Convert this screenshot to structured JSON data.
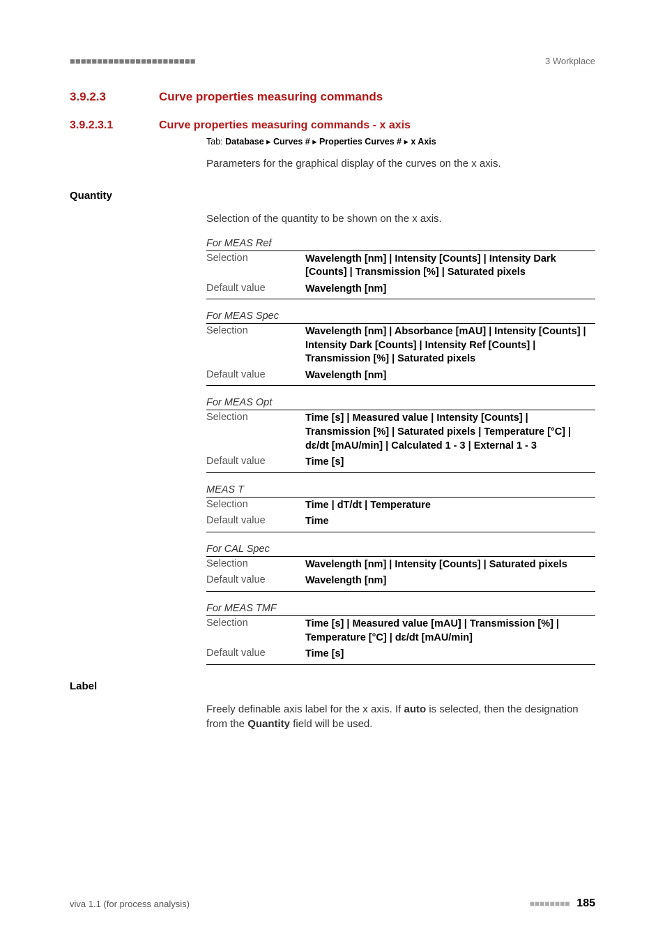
{
  "header": {
    "marks": "■■■■■■■■■■■■■■■■■■■■■■■",
    "right": "3 Workplace"
  },
  "section": {
    "num": "3.9.2.3",
    "title": "Curve properties measuring commands"
  },
  "subsection": {
    "num": "3.9.2.3.1",
    "title": "Curve properties measuring commands - x axis"
  },
  "tabline": {
    "label": "Tab: ",
    "p1": "Database",
    "sep": " ▸ ",
    "p2": "Curves #",
    "p3": "Properties Curves #",
    "p4": "x Axis"
  },
  "intro": "Parameters for the graphical display of the curves on the x axis.",
  "quantity": {
    "heading": "Quantity",
    "lead": "Selection of the quantity to be shown on the x axis.",
    "groups": [
      {
        "title": "For MEAS Ref",
        "rows": [
          {
            "k": "Selection",
            "v": "Wavelength [nm] | Intensity [Counts] | Intensity Dark [Counts] | Transmission [%] | Saturated pixels"
          },
          {
            "k": "Default value",
            "v": "Wavelength [nm]"
          }
        ]
      },
      {
        "title": "For MEAS Spec",
        "rows": [
          {
            "k": "Selection",
            "v": "Wavelength [nm] | Absorbance [mAU] | Intensity [Counts] | Intensity Dark [Counts] | Intensity Ref [Counts] | Transmission [%] | Saturated pixels"
          },
          {
            "k": "Default value",
            "v": "Wavelength [nm]"
          }
        ]
      },
      {
        "title": "For MEAS Opt",
        "rows": [
          {
            "k": "Selection",
            "v": "Time [s] | Measured value | Intensity [Counts] | Transmission [%] | Saturated pixels | Temperature [°C] | dɛ/dt [mAU/min] | Calculated 1 - 3 | External 1 - 3"
          },
          {
            "k": "Default value",
            "v": "Time [s]"
          }
        ]
      },
      {
        "title": "MEAS T",
        "rows": [
          {
            "k": "Selection",
            "v": "Time | dT/dt | Temperature"
          },
          {
            "k": "Default value",
            "v": "Time"
          }
        ]
      },
      {
        "title": "For CAL Spec",
        "rows": [
          {
            "k": "Selection",
            "v": "Wavelength [nm] | Intensity [Counts] | Saturated pixels"
          },
          {
            "k": "Default value",
            "v": "Wavelength [nm]"
          }
        ]
      },
      {
        "title": "For MEAS TMF",
        "rows": [
          {
            "k": "Selection",
            "v": "Time [s] | Measured value [mAU] | Transmission [%] | Temperature [°C] | dɛ/dt [mAU/min]"
          },
          {
            "k": "Default value",
            "v": "Time [s]"
          }
        ]
      }
    ]
  },
  "label_section": {
    "heading": "Label",
    "text_pre": "Freely definable axis label for the x axis. If ",
    "bold1": "auto",
    "text_mid": " is selected, then the designation from the ",
    "bold2": "Quantity",
    "text_post": " field will be used."
  },
  "footer": {
    "left": "viva 1.1 (for process analysis)",
    "marks": "■■■■■■■■",
    "page": "185"
  }
}
